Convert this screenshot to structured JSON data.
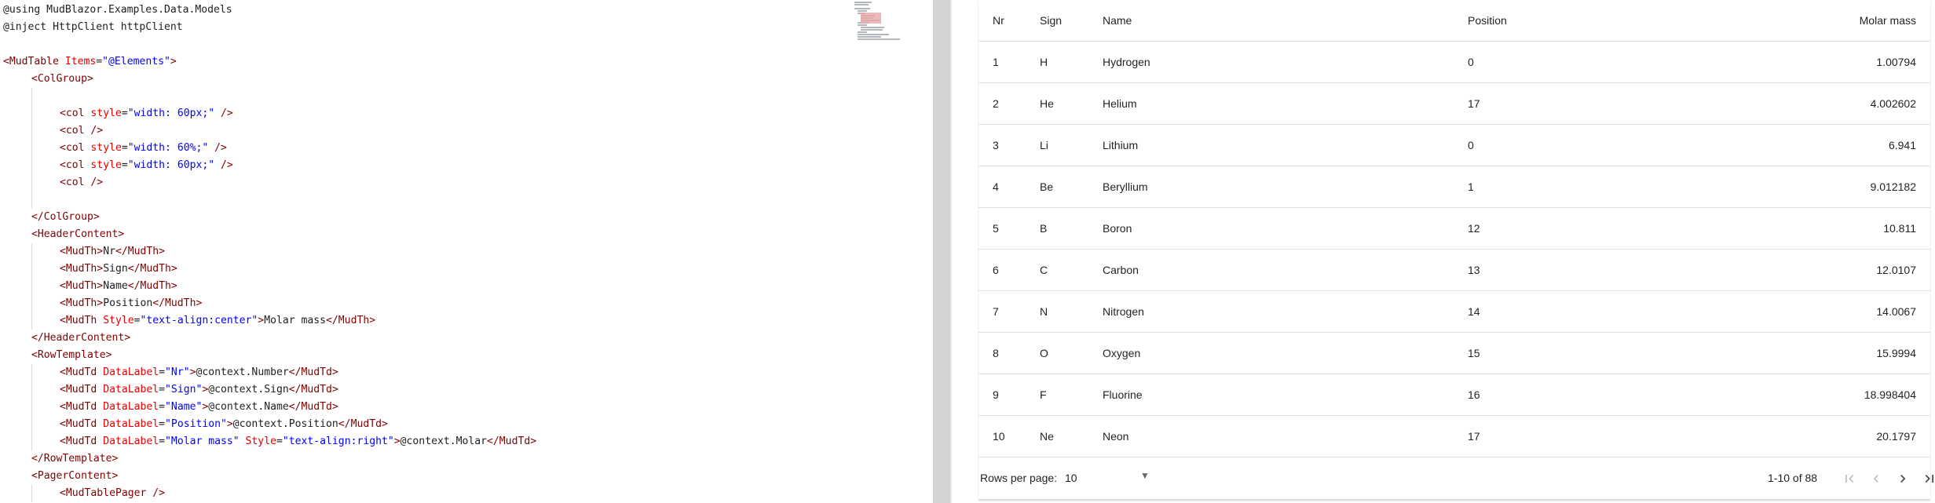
{
  "editor": {
    "lines": [
      {
        "indent": 0,
        "tokens": [
          [
            "dir",
            "@using MudBlazor.Examples.Data.Models"
          ]
        ]
      },
      {
        "indent": 0,
        "tokens": [
          [
            "dir",
            "@inject HttpClient httpClient"
          ]
        ]
      },
      {
        "indent": 0,
        "tokens": []
      },
      {
        "indent": 0,
        "tokens": [
          [
            "tag",
            "<MudTable"
          ],
          [
            "attr",
            " Items"
          ],
          [
            "punct",
            "="
          ],
          [
            "str",
            "\"@Elements\""
          ],
          [
            "tag",
            ">"
          ]
        ]
      },
      {
        "indent": 1,
        "tokens": [
          [
            "tag",
            "<ColGroup>"
          ]
        ]
      },
      {
        "indent": 2,
        "tokens": []
      },
      {
        "indent": 2,
        "tokens": [
          [
            "tag",
            "<col"
          ],
          [
            "attr",
            " style"
          ],
          [
            "punct",
            "="
          ],
          [
            "str",
            "\"width: 60px;\""
          ],
          [
            "tag",
            " />"
          ]
        ]
      },
      {
        "indent": 2,
        "tokens": [
          [
            "tag",
            "<col />"
          ]
        ]
      },
      {
        "indent": 2,
        "tokens": [
          [
            "tag",
            "<col"
          ],
          [
            "attr",
            " style"
          ],
          [
            "punct",
            "="
          ],
          [
            "str",
            "\"width: 60%;\""
          ],
          [
            "tag",
            " />"
          ]
        ]
      },
      {
        "indent": 2,
        "tokens": [
          [
            "tag",
            "<col"
          ],
          [
            "attr",
            " style"
          ],
          [
            "punct",
            "="
          ],
          [
            "str",
            "\"width: 60px;\""
          ],
          [
            "tag",
            " />"
          ]
        ]
      },
      {
        "indent": 2,
        "tokens": [
          [
            "tag",
            "<col />"
          ]
        ]
      },
      {
        "indent": 2,
        "tokens": []
      },
      {
        "indent": 1,
        "tokens": [
          [
            "tag",
            "</ColGroup>"
          ]
        ]
      },
      {
        "indent": 1,
        "tokens": [
          [
            "tag",
            "<HeaderContent>"
          ]
        ]
      },
      {
        "indent": 2,
        "tokens": [
          [
            "tag",
            "<MudTh>"
          ],
          [
            "plain",
            "Nr"
          ],
          [
            "tag",
            "</MudTh>"
          ]
        ]
      },
      {
        "indent": 2,
        "tokens": [
          [
            "tag",
            "<MudTh>"
          ],
          [
            "plain",
            "Sign"
          ],
          [
            "tag",
            "</MudTh>"
          ]
        ]
      },
      {
        "indent": 2,
        "tokens": [
          [
            "tag",
            "<MudTh>"
          ],
          [
            "plain",
            "Name"
          ],
          [
            "tag",
            "</MudTh>"
          ]
        ]
      },
      {
        "indent": 2,
        "tokens": [
          [
            "tag",
            "<MudTh>"
          ],
          [
            "plain",
            "Position"
          ],
          [
            "tag",
            "</MudTh>"
          ]
        ]
      },
      {
        "indent": 2,
        "tokens": [
          [
            "tag",
            "<MudTh"
          ],
          [
            "attr",
            " Style"
          ],
          [
            "punct",
            "="
          ],
          [
            "str",
            "\"text-align:center\""
          ],
          [
            "tag",
            ">"
          ],
          [
            "plain",
            "Molar mass"
          ],
          [
            "tag",
            "</MudTh>"
          ]
        ]
      },
      {
        "indent": 1,
        "tokens": [
          [
            "tag",
            "</HeaderContent>"
          ]
        ]
      },
      {
        "indent": 1,
        "tokens": [
          [
            "tag",
            "<RowTemplate>"
          ]
        ]
      },
      {
        "indent": 2,
        "tokens": [
          [
            "tag",
            "<MudTd"
          ],
          [
            "attr",
            " DataLabel"
          ],
          [
            "punct",
            "="
          ],
          [
            "str",
            "\"Nr\""
          ],
          [
            "tag",
            ">"
          ],
          [
            "plain",
            "@context.Number"
          ],
          [
            "tag",
            "</MudTd>"
          ]
        ]
      },
      {
        "indent": 2,
        "tokens": [
          [
            "tag",
            "<MudTd"
          ],
          [
            "attr",
            " DataLabel"
          ],
          [
            "punct",
            "="
          ],
          [
            "str",
            "\"Sign\""
          ],
          [
            "tag",
            ">"
          ],
          [
            "plain",
            "@context.Sign"
          ],
          [
            "tag",
            "</MudTd>"
          ]
        ]
      },
      {
        "indent": 2,
        "tokens": [
          [
            "tag",
            "<MudTd"
          ],
          [
            "attr",
            " DataLabel"
          ],
          [
            "punct",
            "="
          ],
          [
            "str",
            "\"Name\""
          ],
          [
            "tag",
            ">"
          ],
          [
            "plain",
            "@context.Name"
          ],
          [
            "tag",
            "</MudTd>"
          ]
        ]
      },
      {
        "indent": 2,
        "tokens": [
          [
            "tag",
            "<MudTd"
          ],
          [
            "attr",
            " DataLabel"
          ],
          [
            "punct",
            "="
          ],
          [
            "str",
            "\"Position\""
          ],
          [
            "tag",
            ">"
          ],
          [
            "plain",
            "@context.Position"
          ],
          [
            "tag",
            "</MudTd>"
          ]
        ]
      },
      {
        "indent": 2,
        "tokens": [
          [
            "tag",
            "<MudTd"
          ],
          [
            "attr",
            " DataLabel"
          ],
          [
            "punct",
            "="
          ],
          [
            "str",
            "\"Molar mass\""
          ],
          [
            "attr",
            " Style"
          ],
          [
            "punct",
            "="
          ],
          [
            "str",
            "\"text-align:right\""
          ],
          [
            "tag",
            ">"
          ],
          [
            "plain",
            "@context.Molar"
          ],
          [
            "tag",
            "</MudTd>"
          ]
        ]
      },
      {
        "indent": 1,
        "tokens": [
          [
            "tag",
            "</RowTemplate>"
          ]
        ]
      },
      {
        "indent": 1,
        "tokens": [
          [
            "tag",
            "<PagerContent>"
          ]
        ]
      },
      {
        "indent": 2,
        "tokens": [
          [
            "tag",
            "<MudTablePager />"
          ]
        ]
      }
    ]
  },
  "table": {
    "headers": {
      "nr": "Nr",
      "sign": "Sign",
      "name": "Name",
      "position": "Position",
      "molar": "Molar mass"
    },
    "rows": [
      {
        "nr": "1",
        "sign": "H",
        "name": "Hydrogen",
        "position": "0",
        "molar": "1.00794"
      },
      {
        "nr": "2",
        "sign": "He",
        "name": "Helium",
        "position": "17",
        "molar": "4.002602"
      },
      {
        "nr": "3",
        "sign": "Li",
        "name": "Lithium",
        "position": "0",
        "molar": "6.941"
      },
      {
        "nr": "4",
        "sign": "Be",
        "name": "Beryllium",
        "position": "1",
        "molar": "9.012182"
      },
      {
        "nr": "5",
        "sign": "B",
        "name": "Boron",
        "position": "12",
        "molar": "10.811"
      },
      {
        "nr": "6",
        "sign": "C",
        "name": "Carbon",
        "position": "13",
        "molar": "12.0107"
      },
      {
        "nr": "7",
        "sign": "N",
        "name": "Nitrogen",
        "position": "14",
        "molar": "14.0067"
      },
      {
        "nr": "8",
        "sign": "O",
        "name": "Oxygen",
        "position": "15",
        "molar": "15.9994"
      },
      {
        "nr": "9",
        "sign": "F",
        "name": "Fluorine",
        "position": "16",
        "molar": "18.998404"
      },
      {
        "nr": "10",
        "sign": "Ne",
        "name": "Neon",
        "position": "17",
        "molar": "20.1797"
      }
    ]
  },
  "pager": {
    "rows_per_page_label": "Rows per page:",
    "rows_per_page_value": "10",
    "range_text": "1-10 of 88",
    "icons": {
      "first": "first-page-icon",
      "prev": "chevron-left-icon",
      "next": "chevron-right-icon",
      "last": "last-page-icon",
      "dropdown": "arrow-drop-down-icon"
    }
  },
  "colors": {
    "tag": "#800000",
    "attr": "#e50000",
    "string": "#0000ff",
    "scrollbar": "#d3d3d3"
  }
}
